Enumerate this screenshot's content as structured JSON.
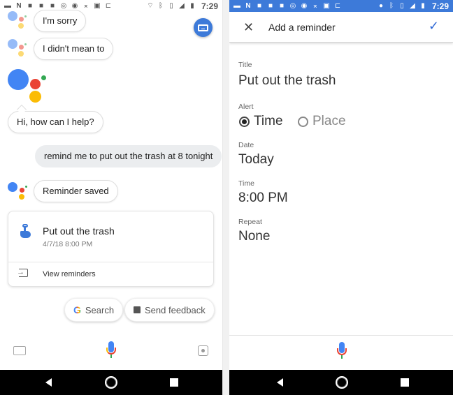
{
  "left_screen": {
    "status_bar": {
      "notification_icons": [
        "message-icon",
        "netflix-icon",
        "facebook-icon",
        "facebook-icon",
        "facebook-icon",
        "cast-icon",
        "chrome-icon",
        "missed-call-icon",
        "image-icon",
        "flipboard-icon"
      ],
      "system_icons": [
        "wifi-icon",
        "bluetooth-icon",
        "vibrate-icon",
        "signal-icon",
        "battery-icon"
      ],
      "time": "7:29"
    },
    "messages": [
      {
        "from": "assistant",
        "text": "I'm sorry"
      },
      {
        "from": "assistant",
        "text": "I didn't mean to"
      },
      {
        "from": "assistant",
        "text": "Hi, how can I help?"
      },
      {
        "from": "user",
        "text": "remind me to put out the trash at 8 tonight"
      },
      {
        "from": "assistant",
        "text": "Reminder saved"
      }
    ],
    "reminder_card": {
      "title": "Put out the trash",
      "datetime": "4/7/18 8:00 PM",
      "action_label": "View reminders"
    },
    "chips": [
      {
        "label": "Search",
        "icon": "google-g-icon"
      },
      {
        "label": "Send feedback",
        "icon": "feedback-icon"
      }
    ],
    "colors": {
      "blue": "#4285f4",
      "red": "#ea4335",
      "yellow": "#fbbc05",
      "green": "#34a853"
    }
  },
  "right_screen": {
    "status_bar": {
      "notification_icons": [
        "message-icon",
        "netflix-icon",
        "facebook-icon",
        "facebook-icon",
        "facebook-icon",
        "cast-icon",
        "chrome-icon",
        "missed-call-icon",
        "image-icon",
        "flipboard-icon"
      ],
      "system_icons": [
        "location-icon",
        "bluetooth-icon",
        "vibrate-icon",
        "signal-icon",
        "battery-icon"
      ],
      "time": "7:29",
      "color": "#3d7ad9"
    },
    "app_bar": {
      "title": "Add a reminder"
    },
    "fields": {
      "title_label": "Title",
      "title_value": "Put out the trash",
      "alert_label": "Alert",
      "alert_options": [
        {
          "label": "Time",
          "selected": true
        },
        {
          "label": "Place",
          "selected": false
        }
      ],
      "date_label": "Date",
      "date_value": "Today",
      "time_label": "Time",
      "time_value": "8:00 PM",
      "repeat_label": "Repeat",
      "repeat_value": "None"
    }
  }
}
